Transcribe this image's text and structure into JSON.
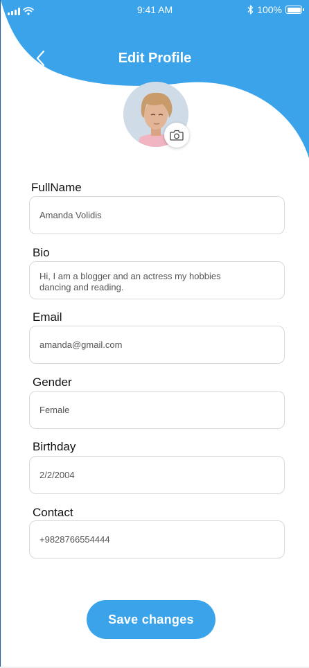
{
  "status_bar": {
    "time": "9:41 AM",
    "battery": "100%"
  },
  "header": {
    "title": "Edit Profile",
    "back_icon": "chevron-left-icon",
    "accent_color": "#3ba3ea"
  },
  "avatar": {
    "camera_icon": "camera-icon"
  },
  "form": {
    "fields": [
      {
        "label": "FullName",
        "value": "Amanda Volidis"
      },
      {
        "label": "Bio",
        "value": "Hi, I am a blogger and an actress my hobbies\ndancing and reading."
      },
      {
        "label": "Email",
        "value": "amanda@gmail.com"
      },
      {
        "label": "Gender",
        "value": "Female"
      },
      {
        "label": "Birthday",
        "value": "2/2/2004"
      },
      {
        "label": "Contact",
        "value": "+9828766554444"
      }
    ]
  },
  "actions": {
    "save_label": "Save changes"
  }
}
